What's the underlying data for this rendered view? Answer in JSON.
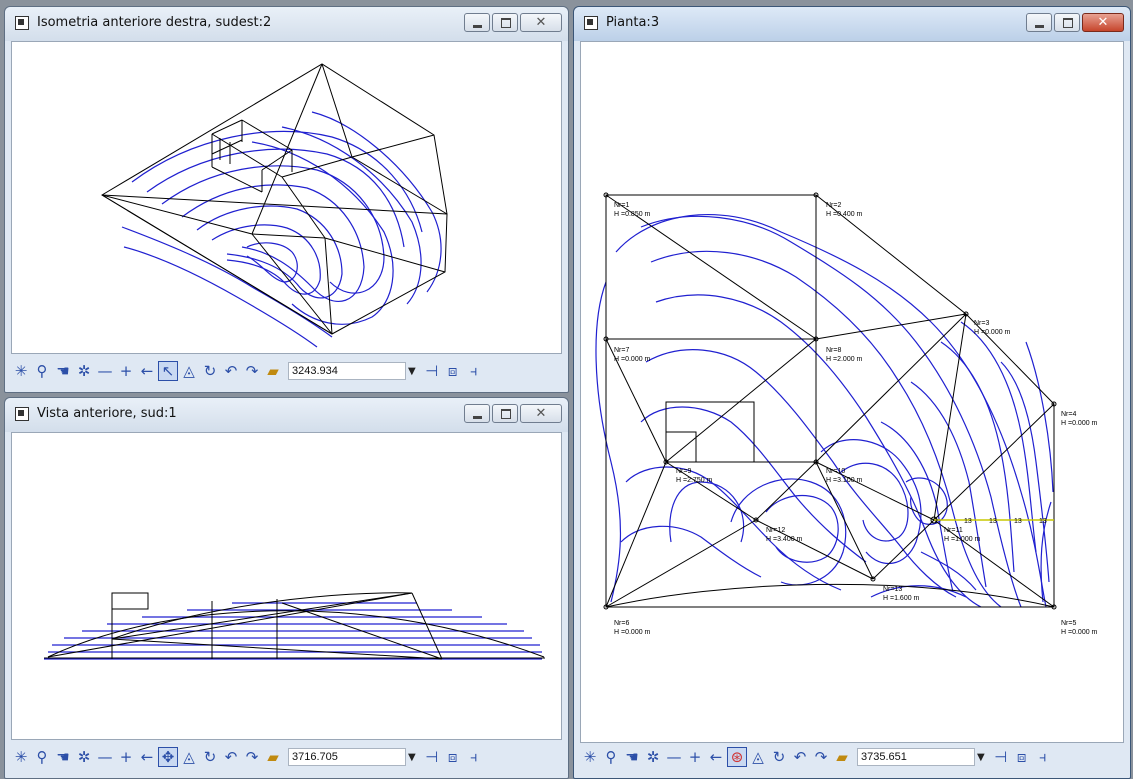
{
  "windows": [
    {
      "title": "Isometria anteriore destra, sudest:2",
      "zoom": "3243.934"
    },
    {
      "title": "Vista anteriore, sud:1",
      "zoom": "3716.705"
    },
    {
      "title": "Pianta:3",
      "zoom": "3735.651"
    }
  ],
  "icons": {
    "toolbar": [
      "asterisk-icon",
      "zoom-icon",
      "pan-hand-icon",
      "sparkle-icon",
      "minus-icon",
      "plus-icon",
      "arrow-left-icon",
      "select-arrow-icon",
      "orbit-icon",
      "rotate-icon",
      "undo-icon",
      "redo-icon",
      "folder-open-icon"
    ],
    "toolbar_right": [
      "pin-icon",
      "cube-icon",
      "split-icon"
    ]
  },
  "colors": {
    "contour": "#2020d0",
    "edge": "#000000",
    "highlight": "#c8c800"
  },
  "plan": {
    "labels": [
      {
        "n": "Nr=1",
        "h": "H =0.850  m"
      },
      {
        "n": "Nr=2",
        "h": "H =0.400  m"
      },
      {
        "n": "Nr=3",
        "h": "H =0.000  m"
      },
      {
        "n": "Nr=4",
        "h": "H =0.000  m"
      },
      {
        "n": "Nr=5",
        "h": "H =0.000  m"
      },
      {
        "n": "Nr=6",
        "h": "H =0.000  m"
      },
      {
        "n": "Nr=7",
        "h": "H =0.000  m"
      },
      {
        "n": "Nr=8",
        "h": "H =2.000  m"
      },
      {
        "n": "Nr=9",
        "h": "H =2.750  m"
      },
      {
        "n": "Nr=10",
        "h": "H =3.100  m"
      },
      {
        "n": "Nr=11",
        "h": "H =1.000  m"
      },
      {
        "n": "Nr=12",
        "h": "H =3.400  m"
      },
      {
        "n": "Nr=13",
        "h": "H =1.600  m"
      }
    ],
    "markers": [
      "13",
      "13",
      "13",
      "13"
    ]
  }
}
